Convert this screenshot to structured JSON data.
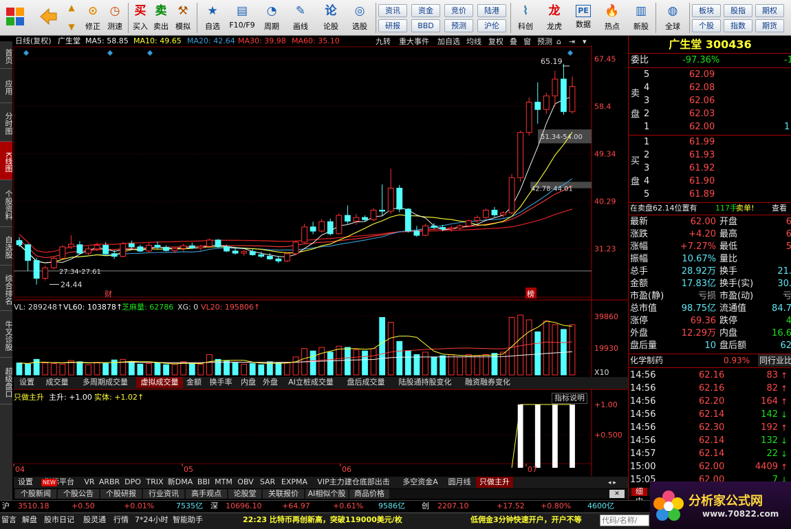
{
  "toolbar": {
    "buttons": [
      {
        "name": "buy",
        "label": "买入",
        "icon": "买",
        "color": "#d00"
      },
      {
        "name": "sell",
        "label": "卖出",
        "icon": "卖",
        "color": "#080"
      },
      {
        "name": "simulate",
        "label": "模拟",
        "icon": "⚒",
        "color": "#a50"
      }
    ],
    "left_buttons": [
      {
        "label": "修正",
        "icon": "⊙"
      },
      {
        "label": "测速",
        "icon": "◷"
      }
    ],
    "mid_buttons": [
      {
        "label": "自选",
        "icon": "★"
      },
      {
        "label": "F10/F9",
        "icon": "▤"
      },
      {
        "label": "周期",
        "icon": "◔"
      },
      {
        "label": "画线",
        "icon": "✎"
      },
      {
        "label": "论股",
        "icon": "论"
      },
      {
        "label": "选股",
        "icon": "◎"
      }
    ],
    "text_buttons": [
      [
        "资讯",
        "研报"
      ],
      [
        "资金",
        "BBD"
      ],
      [
        "竞价",
        "预测"
      ],
      [
        "陆港",
        "沪伦"
      ]
    ],
    "right_buttons": [
      {
        "label": "科创",
        "icon": "⌇"
      },
      {
        "label": "龙虎",
        "icon": "龙"
      },
      {
        "label": "数据",
        "icon": "PE"
      },
      {
        "label": "热点",
        "icon": "🔥"
      },
      {
        "label": "新股",
        "icon": "▥"
      },
      {
        "label": "全球",
        "icon": "◍"
      }
    ],
    "far_text": [
      [
        "板块",
        "个股"
      ],
      [
        "股指",
        "指数"
      ],
      [
        "期权",
        "期货"
      ]
    ]
  },
  "sidebar": [
    "首页",
    "应用",
    "分时图",
    "K线图",
    "个股资料",
    "自选股",
    "综合排名",
    "牛叉诊股",
    "超级盘口"
  ],
  "chart_header": {
    "period": "日线(复权)",
    "stock": "广生堂",
    "ma": [
      {
        "label": "MA5: 58.85",
        "color": "#f0f0f0"
      },
      {
        "label": "MA10: 49.65",
        "color": "#ffff33"
      },
      {
        "label": "MA20: 42.64",
        "color": "#3c9dd8"
      },
      {
        "label": "MA30: 39.98",
        "color": "#ff3a3a"
      },
      {
        "label": "MA60: 35.10",
        "color": "#ff3a3a"
      }
    ],
    "tabs": [
      "九转",
      "重大事件",
      "加自选",
      "均线",
      "复权",
      "叠",
      "窗",
      "预测"
    ]
  },
  "chart_data": [
    {
      "type": "candlestick",
      "title": "日线(复权) 广生堂",
      "ylim": [
        22.0,
        69.5
      ],
      "y_ticks": [
        "67.45",
        "58.40",
        "49.34",
        "40.29",
        "31.23"
      ],
      "x_ticks": [
        "04",
        "05",
        "06",
        "07"
      ],
      "annotations": [
        "65.19",
        "51.34-54.00",
        "42.78-44.01",
        "27.34-27.61",
        "24.44",
        "财",
        "榜"
      ],
      "candles": [
        [
          32.8,
          33.5,
          31.6,
          32.0
        ],
        [
          32.0,
          32.2,
          27.0,
          29.0
        ],
        [
          29.0,
          29.5,
          24.4,
          25.6
        ],
        [
          25.6,
          28.0,
          25.2,
          27.6
        ],
        [
          27.6,
          29.6,
          27.3,
          29.4
        ],
        [
          29.4,
          31.9,
          29.3,
          31.6
        ],
        [
          31.6,
          33.8,
          31.2,
          32.1
        ],
        [
          32.0,
          32.7,
          30.2,
          30.4
        ],
        [
          30.4,
          31.7,
          30.0,
          31.2
        ],
        [
          31.2,
          32.4,
          30.8,
          31.9
        ],
        [
          31.9,
          32.5,
          30.1,
          30.3
        ],
        [
          30.3,
          31.0,
          29.3,
          29.8
        ],
        [
          29.8,
          32.5,
          29.6,
          32.2
        ],
        [
          32.2,
          32.8,
          31.2,
          31.6
        ],
        [
          31.6,
          32.0,
          30.6,
          30.8
        ],
        [
          30.8,
          32.4,
          30.5,
          31.9
        ],
        [
          31.9,
          32.6,
          31.2,
          31.5
        ],
        [
          31.5,
          31.9,
          30.7,
          30.9
        ],
        [
          30.9,
          31.5,
          30.4,
          31.3
        ],
        [
          31.3,
          32.2,
          30.8,
          31.8
        ],
        [
          31.8,
          32.4,
          31.2,
          31.4
        ],
        [
          31.4,
          32.0,
          30.9,
          31.7
        ],
        [
          31.7,
          33.2,
          31.3,
          32.9
        ],
        [
          32.9,
          33.1,
          31.4,
          31.6
        ],
        [
          31.6,
          32.0,
          30.6,
          30.8
        ],
        [
          30.8,
          31.4,
          30.1,
          30.4
        ],
        [
          30.4,
          31.0,
          29.9,
          30.7
        ],
        [
          30.7,
          31.2,
          29.9,
          30.1
        ],
        [
          30.1,
          30.7,
          29.5,
          29.8
        ],
        [
          29.8,
          30.4,
          29.1,
          29.3
        ],
        [
          29.3,
          29.9,
          28.5,
          28.9
        ],
        [
          28.9,
          30.6,
          28.7,
          30.3
        ],
        [
          30.3,
          32.8,
          30.0,
          32.5
        ],
        [
          32.5,
          36.0,
          32.3,
          35.4
        ],
        [
          35.4,
          36.4,
          34.0,
          34.6
        ],
        [
          34.6,
          36.9,
          34.3,
          36.4
        ],
        [
          36.4,
          37.0,
          33.8,
          34.1
        ],
        [
          34.1,
          38.0,
          34.0,
          37.6
        ],
        [
          37.6,
          39.5,
          36.0,
          36.5
        ],
        [
          36.5,
          37.9,
          35.8,
          37.2
        ],
        [
          37.2,
          37.6,
          36.4,
          36.8
        ],
        [
          36.8,
          39.0,
          36.5,
          38.6
        ],
        [
          38.6,
          43.5,
          37.6,
          38.4
        ],
        [
          38.4,
          46.5,
          37.9,
          42.8
        ],
        [
          42.8,
          43.4,
          38.2,
          38.8
        ],
        [
          38.8,
          39.0,
          34.3,
          34.6
        ],
        [
          34.6,
          35.6,
          33.5,
          33.8
        ],
        [
          33.8,
          36.0,
          33.6,
          35.6
        ],
        [
          35.6,
          36.1,
          35.0,
          35.3
        ],
        [
          35.3,
          35.8,
          34.6,
          35.0
        ],
        [
          35.0,
          35.6,
          34.5,
          35.2
        ],
        [
          35.2,
          35.9,
          34.8,
          35.6
        ],
        [
          35.6,
          36.8,
          35.4,
          36.6
        ],
        [
          36.6,
          37.6,
          36.2,
          37.2
        ],
        [
          37.2,
          38.9,
          36.9,
          38.6
        ],
        [
          38.6,
          39.2,
          37.3,
          37.7
        ],
        [
          37.7,
          38.4,
          37.2,
          38.1
        ],
        [
          38.1,
          45.5,
          37.8,
          44.8
        ],
        [
          44.8,
          53.8,
          44.0,
          53.4
        ],
        [
          53.4,
          60.1,
          52.8,
          59.2
        ],
        [
          59.2,
          63.0,
          55.1,
          57.8
        ],
        [
          57.8,
          61.0,
          56.9,
          60.4
        ],
        [
          60.4,
          65.2,
          58.4,
          63.6
        ],
        [
          63.6,
          66.5,
          56.8,
          57.4
        ],
        [
          57.4,
          64.1,
          57.0,
          62.2
        ]
      ]
    },
    {
      "type": "bar",
      "title": "VL: 289248 VL60: 103878 芝麻量: 62786 XG: 0 VL20: 195806",
      "y_ticks": [
        "39860",
        "19930",
        "X10"
      ],
      "values": [
        20,
        18,
        26,
        20,
        19,
        18,
        24,
        22,
        17,
        21,
        19,
        25,
        26,
        22,
        18,
        19,
        20,
        17,
        18,
        22,
        19,
        18,
        34,
        26,
        24,
        20,
        18,
        19,
        17,
        22,
        20,
        21,
        30,
        44,
        40,
        46,
        38,
        48,
        46,
        42,
        40,
        44,
        96,
        88,
        56,
        40,
        34,
        38,
        30,
        32,
        34,
        30,
        34,
        32,
        34,
        36,
        38,
        96,
        100,
        92,
        72,
        90,
        84,
        76,
        84
      ]
    },
    {
      "type": "line",
      "title": "只做主升 主升: +1.00 实体: +1.02",
      "y_ticks": [
        "+1.00",
        "+0.500"
      ],
      "series": [
        {
          "name": "主升",
          "values": [
            0,
            0,
            0,
            0,
            0,
            0,
            0,
            0,
            0,
            0,
            0,
            0,
            0,
            0,
            0,
            0,
            0,
            0,
            0,
            0,
            0,
            0,
            0,
            0,
            0,
            0,
            0,
            0,
            0,
            0,
            0,
            0,
            0,
            0,
            0,
            0,
            0,
            0,
            0,
            0,
            0,
            0,
            0,
            0,
            0,
            0,
            0,
            0,
            0,
            0,
            0,
            0,
            0,
            0,
            0,
            0,
            0,
            0,
            1,
            1,
            1,
            1,
            1,
            1,
            1
          ]
        }
      ]
    }
  ],
  "vol_header": {
    "vl": "VL: 289248↑",
    "vl60": "VL60: 103878↑",
    "zhima": "芝麻量: 62786",
    "xg": "XG: 0",
    "vl20": "VL20: 195806↑"
  },
  "ind_header": {
    "name": "只做主升",
    "zs": "主升: +1.00",
    "st": "实体: +1.02↑",
    "help": "指标说明"
  },
  "vol_tabs": [
    "设置",
    "成交量",
    "多周期成交量",
    "虚拟成交量",
    "金额",
    "换手率",
    "内盘",
    "外盘",
    "AI立桩成交量",
    "盘后成交量",
    "陆股通持股变化",
    "融资融券变化"
  ],
  "vol_tab_active": "虚拟成交量",
  "indicator_tabs": [
    "设置",
    "指标平台",
    "VR",
    "ARBR",
    "DPO",
    "TRIX",
    "新DMA",
    "BBI",
    "MTM",
    "OBV",
    "SAR",
    "EXPMA",
    "VIP主力建仓底部出击",
    "多空资金A",
    "圆月线",
    "只做主升"
  ],
  "indicator_tab_active": "只做主升",
  "new_badge": "NEW",
  "news_tabs": [
    "个股新闻",
    "个股公告",
    "个股研报",
    "行业资讯",
    "高手观点",
    "论股堂",
    "关联报价",
    "AI相似个股",
    "商品价格"
  ],
  "quote": {
    "name": "广生堂",
    "code": "300436",
    "weibi_label": "委比",
    "weibi": "-97.36%",
    "weibi_right": "-1",
    "sell_label": "卖盘",
    "buy_label": "买盘",
    "sells": [
      {
        "n": "5",
        "p": "62.09",
        "v": ""
      },
      {
        "n": "4",
        "p": "62.08",
        "v": ""
      },
      {
        "n": "3",
        "p": "62.06",
        "v": ""
      },
      {
        "n": "2",
        "p": "62.03",
        "v": ""
      },
      {
        "n": "1",
        "p": "62.00",
        "v": "1"
      }
    ],
    "buys": [
      {
        "n": "1",
        "p": "61.99",
        "v": ""
      },
      {
        "n": "2",
        "p": "61.93",
        "v": ""
      },
      {
        "n": "3",
        "p": "61.92",
        "v": ""
      },
      {
        "n": "4",
        "p": "61.90",
        "v": ""
      },
      {
        "n": "5",
        "p": "61.89",
        "v": ""
      }
    ],
    "order_note": "在卖盘62.14位置有",
    "order_qty": "117手",
    "order_tag": "卖单!",
    "order_view": "查看",
    "stats": [
      {
        "l": "最新",
        "v": "62.00",
        "vc": "red",
        "l2": "开盘",
        "v2": "6",
        "v2c": "red"
      },
      {
        "l": "涨跌",
        "v": "+4.20",
        "vc": "red",
        "l2": "最高",
        "v2": "6",
        "v2c": "red"
      },
      {
        "l": "涨幅",
        "v": "+7.27%",
        "vc": "red",
        "l2": "最低",
        "v2": "5",
        "v2c": "red"
      },
      {
        "l": "振幅",
        "v": "10.67%",
        "vc": "cy",
        "l2": "量比",
        "v2": "",
        "v2c": "cy"
      },
      {
        "l": "总手",
        "v": "28.92万",
        "vc": "cy",
        "l2": "换手",
        "v2": "21.",
        "v2c": "cy"
      },
      {
        "l": "金额",
        "v": "17.83亿",
        "vc": "cy",
        "l2": "换手(实)",
        "v2": "30.",
        "v2c": "cy"
      },
      {
        "l": "市盈(静)",
        "v": "亏损",
        "vc": "gry",
        "l2": "市盈(动)",
        "v2": "亏",
        "v2c": "gry"
      },
      {
        "l": "总市值",
        "v": "98.75亿",
        "vc": "cy",
        "l2": "流通值",
        "v2": "84.7",
        "v2c": "cy"
      },
      {
        "l": "涨停",
        "v": "69.36",
        "vc": "red",
        "l2": "跌停",
        "v2": "4",
        "v2c": "grn"
      },
      {
        "l": "外盘",
        "v": "12.29万",
        "vc": "red",
        "l2": "内盘",
        "v2": "16.6",
        "v2c": "grn"
      },
      {
        "l": "盘后量",
        "v": "10",
        "vc": "cy",
        "l2": "盘后额",
        "v2": "62",
        "v2c": "cy"
      }
    ],
    "industry": "化学制药",
    "industry_pct": "0.93%",
    "industry_tab": "同行业比",
    "ticks": [
      {
        "t": "14:56",
        "p": "62.16",
        "v": "83",
        "d": "up"
      },
      {
        "t": "14:56",
        "p": "62.16",
        "v": "82",
        "d": "up"
      },
      {
        "t": "14:56",
        "p": "62.20",
        "v": "164",
        "d": "up"
      },
      {
        "t": "14:56",
        "p": "62.14",
        "v": "142",
        "d": "down"
      },
      {
        "t": "14:56",
        "p": "62.30",
        "v": "192",
        "d": "up"
      },
      {
        "t": "14:56",
        "p": "62.14",
        "v": "132",
        "d": "down"
      },
      {
        "t": "14:57",
        "p": "62.14",
        "v": "22",
        "d": "down"
      },
      {
        "t": "15:00",
        "p": "62.00",
        "v": "4409",
        "d": "up"
      },
      {
        "t": "15:05",
        "p": "62.00",
        "v": "7",
        "d": "down"
      }
    ],
    "bottom_tabs": [
      "细",
      "中"
    ]
  },
  "indices": [
    {
      "name": "沪",
      "val": "3510.18",
      "chg": "+0.50",
      "pct": "+0.01%",
      "amt": "7535亿"
    },
    {
      "name": "深",
      "val": "10696.10",
      "chg": "+64.97",
      "pct": "+0.61%",
      "amt": "9586亿"
    },
    {
      "name": "创",
      "val": "2207.10",
      "chg": "+17.52",
      "pct": "+0.80%",
      "amt": "4600亿"
    }
  ],
  "status": {
    "items": [
      "留言",
      "解盘",
      "股市日记",
      "股灵通",
      "行情",
      "7*24小时",
      "智能助手"
    ],
    "news": "22:23 比特币再创新高，突破119000美元/枚",
    "ad": "低佣金3分钟快速开户，开户不等",
    "search_placeholder": "代码/名称/"
  },
  "logo": {
    "text": "分析家公式网",
    "url": "www.70822.com"
  }
}
